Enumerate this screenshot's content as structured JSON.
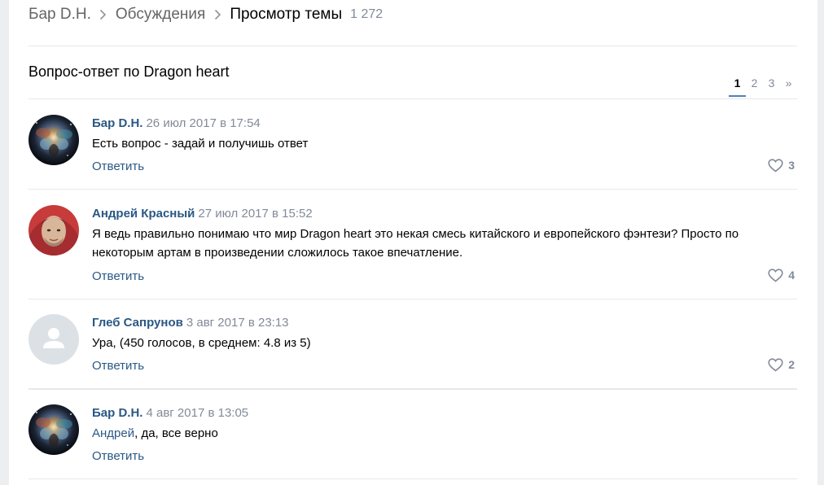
{
  "breadcrumb": {
    "group": "Бар D.H.",
    "section": "Обсуждения",
    "current": "Просмотр темы",
    "count": "1 272"
  },
  "topic": {
    "title": "Вопрос-ответ по Dragon heart"
  },
  "pagination": {
    "pages": [
      "1",
      "2",
      "3"
    ],
    "current": "1",
    "next": "»"
  },
  "posts": [
    {
      "author": "Бар D.H.",
      "date": "26 июл 2017 в 17:54",
      "text": "Есть вопрос - задай и получишь ответ",
      "reply": "Ответить",
      "likes": "3",
      "avatar": "nebula-avatar"
    },
    {
      "author": "Андрей Красный",
      "date": "27 июл 2017 в 15:52",
      "text": "Я ведь правильно понимаю что мир Dragon heart это некая смесь китайского и европейского фэнтези? Просто по некоторым артам в произведении сложилось такое впечатление.",
      "reply": "Ответить",
      "likes": "4",
      "avatar": "photo-avatar"
    },
    {
      "author": "Глеб Сапрунов",
      "date": "3 авг 2017 в 23:13",
      "text": "Ура, (450 голосов, в среднем: 4.8 из 5)",
      "reply": "Ответить",
      "likes": "2",
      "avatar": "default-user-avatar"
    },
    {
      "author": "Бар D.H.",
      "date": "4 авг 2017 в 13:05",
      "mention": "Андрей",
      "text": ", да, все верно",
      "reply": "Ответить",
      "avatar": "nebula-avatar"
    }
  ],
  "colors": {
    "link": "#2a5885",
    "muted": "#828a99",
    "divider": "#e7e8ec",
    "accent": "#5181b8",
    "background": "#edeef0"
  }
}
